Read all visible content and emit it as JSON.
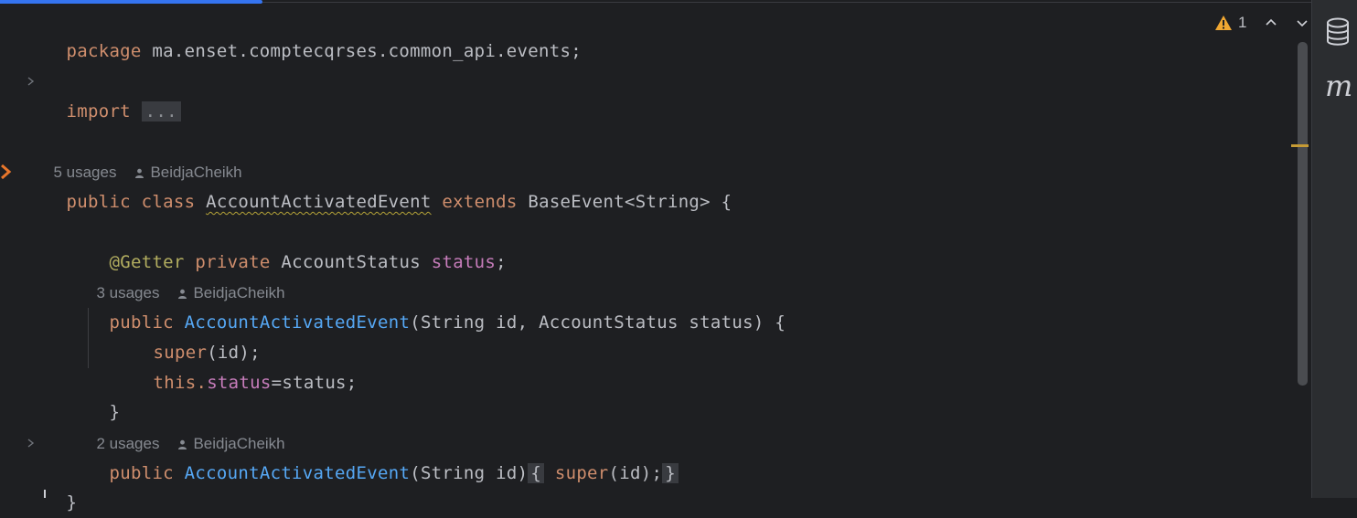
{
  "editor": {
    "package_line": "package ma.enset.comptecqrses.common_api.events;",
    "import_keyword": "import",
    "import_folded": "...",
    "class_hint": {
      "usages": "5 usages",
      "author": "BeidjaCheikh"
    },
    "class_decl": {
      "kw_public": "public",
      "kw_class": "class",
      "name": "AccountActivatedEvent",
      "kw_extends": "extends",
      "parent": "BaseEvent<String>",
      "brace": "{"
    },
    "field_line": {
      "annotation": "@Getter",
      "kw_private": "private",
      "type": "AccountStatus",
      "field": "status",
      "semicolon": ";"
    },
    "ctor1_hint": {
      "usages": "3 usages",
      "author": "BeidjaCheikh"
    },
    "ctor1": {
      "kw_public": "public",
      "name": "AccountActivatedEvent",
      "params": "(String id, AccountStatus status) {"
    },
    "ctor1_body1": {
      "kw_super": "super",
      "rest": "(id);"
    },
    "ctor1_body2": {
      "kw_this": "this.",
      "field": "status",
      "rest": "=status;"
    },
    "ctor1_close": "}",
    "ctor2_hint": {
      "usages": "2 usages",
      "author": "BeidjaCheikh"
    },
    "ctor2": {
      "kw_public": "public",
      "name": "AccountActivatedEvent",
      "params": "(String id)",
      "fold_open": "{",
      "kw_super": "super",
      "body": "(id);",
      "fold_close": "}"
    },
    "class_close": "}"
  },
  "inspections": {
    "warning_count": "1"
  },
  "icons": {
    "warning": "warning-triangle-icon",
    "prev": "chevron-up-icon",
    "next": "chevron-down-icon",
    "database": "database-icon",
    "maven": "maven-m-icon"
  },
  "colors": {
    "background": "#1e1f22",
    "keyword": "#cf8e6d",
    "field": "#c77dbb",
    "method": "#56a8f5",
    "annotation": "#b3ae60",
    "text": "#bcbec4",
    "hint": "#868a91",
    "progress": "#3574f0",
    "warning": "#f0a732"
  }
}
